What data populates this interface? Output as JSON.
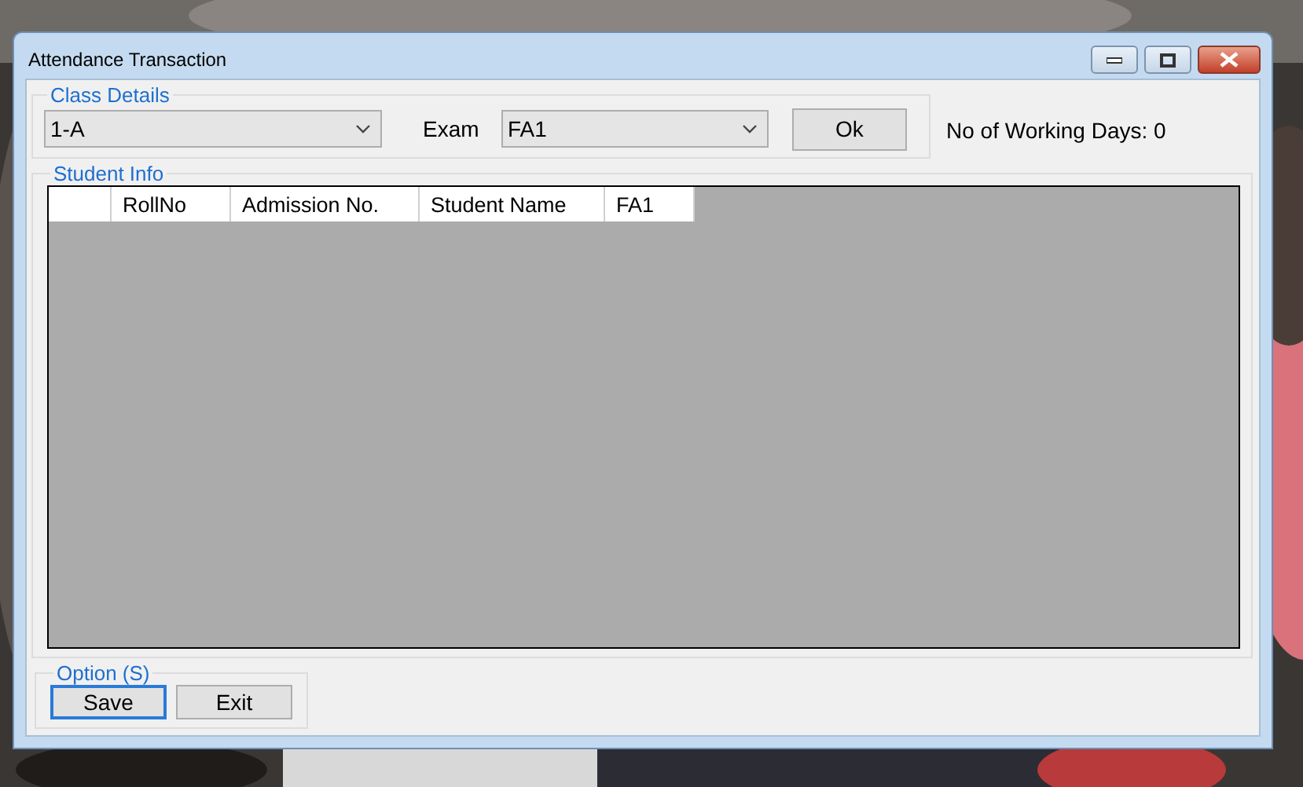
{
  "window": {
    "title": "Attendance Transaction"
  },
  "class_details": {
    "legend": "Class Details",
    "class_combo": {
      "value": "1-A"
    },
    "exam_label": "Exam",
    "exam_combo": {
      "value": "FA1"
    },
    "ok_button": "Ok"
  },
  "working_days": "No of Working Days: 0",
  "student_info": {
    "legend": "Student Info",
    "table": {
      "columns": [
        "RollNo",
        "Admission No.",
        "Student Name",
        "FA1"
      ]
    }
  },
  "options": {
    "legend": "Option (S)",
    "buttons": [
      {
        "label": "Save",
        "default": true
      },
      {
        "label": "Exit",
        "default": false
      }
    ]
  }
}
